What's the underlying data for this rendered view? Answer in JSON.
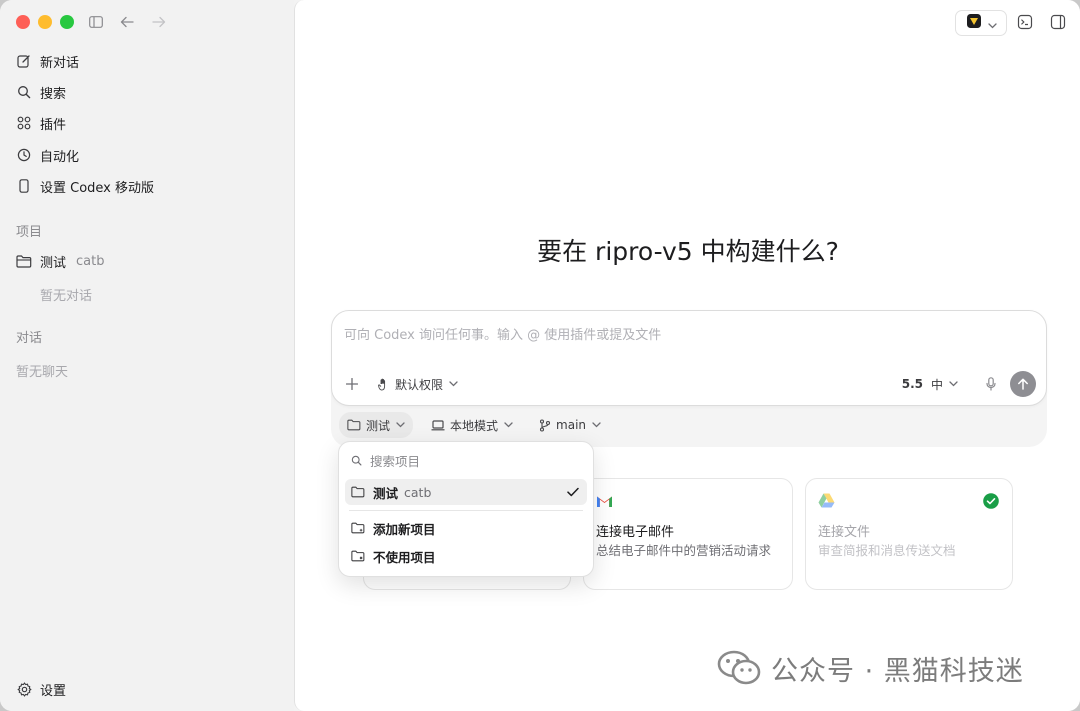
{
  "sidebar": {
    "nav": [
      {
        "label": "新对话",
        "icon": "compose-icon"
      },
      {
        "label": "搜索",
        "icon": "search-icon"
      },
      {
        "label": "插件",
        "icon": "plugins-icon"
      },
      {
        "label": "自动化",
        "icon": "clock-icon"
      },
      {
        "label": "设置 Codex 移动版",
        "icon": "phone-icon"
      }
    ],
    "projects_label": "项目",
    "project": {
      "name": "测试",
      "tag": "catb",
      "empty": "暂无对话"
    },
    "chats_label": "对话",
    "chats_empty": "暂无聊天",
    "settings_label": "设置"
  },
  "main": {
    "heading": "要在 ripro-v5 中构建什么?",
    "composer": {
      "placeholder": "可向 Codex 询问任何事。输入 @ 使用插件或提及文件",
      "permission": "默认权限",
      "model": "5.5",
      "effort": "中"
    },
    "subbar": {
      "project": "测试",
      "mode": "本地模式",
      "branch": "main"
    },
    "cards": [
      {
        "title": "连接电子邮件",
        "desc": "总结电子邮件中的营销活动请求"
      },
      {
        "title": "连接文件",
        "desc": "审查简报和消息传送文档"
      }
    ],
    "dropdown": {
      "search_placeholder": "搜索项目",
      "items": [
        {
          "name": "测试",
          "tag": "catb",
          "selected": true
        },
        {
          "name": "添加新项目"
        },
        {
          "name": "不使用项目"
        }
      ]
    },
    "watermark": "公众号 · 黑猫科技迷"
  },
  "colors": {
    "send_button": "#8e8e93",
    "check_green": "#1a9e47",
    "close": "#fe5f57",
    "minimize": "#febc2e",
    "zoom": "#28c840"
  }
}
